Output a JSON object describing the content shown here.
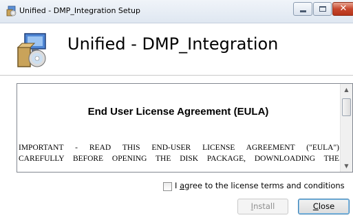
{
  "window": {
    "title": "Unified - DMP_Integration Setup",
    "icon": "setup-package-icon",
    "controls": [
      "minimize-icon",
      "maximize-icon",
      "close-icon"
    ],
    "close_glyph": "✕"
  },
  "header": {
    "title": "Unified - DMP_Integration",
    "icon": "setup-package-icon"
  },
  "eula": {
    "heading": "End User License Agreement (EULA)",
    "lines": [
      "IMPORTANT - READ THIS END-USER LICENSE AGREEMENT (\"EULA\")",
      "CAREFULLY BEFORE OPENING THE DISK PACKAGE, DOWNLOADING THE"
    ],
    "scroll_up_glyph": "▲",
    "scroll_down_glyph": "▼"
  },
  "agree": {
    "checked": false,
    "label_prefix": "I ",
    "label_mnemonic": "a",
    "label_rest": "gree to the license terms and conditions"
  },
  "buttons": {
    "install_mnemonic": "I",
    "install_rest": "nstall",
    "install_enabled": false,
    "close_mnemonic": "C",
    "close_rest": "lose"
  },
  "colors": {
    "titlebar": "#dfe7f1",
    "close_button": "#c7472d",
    "default_button_border": "#3c7fb1"
  }
}
